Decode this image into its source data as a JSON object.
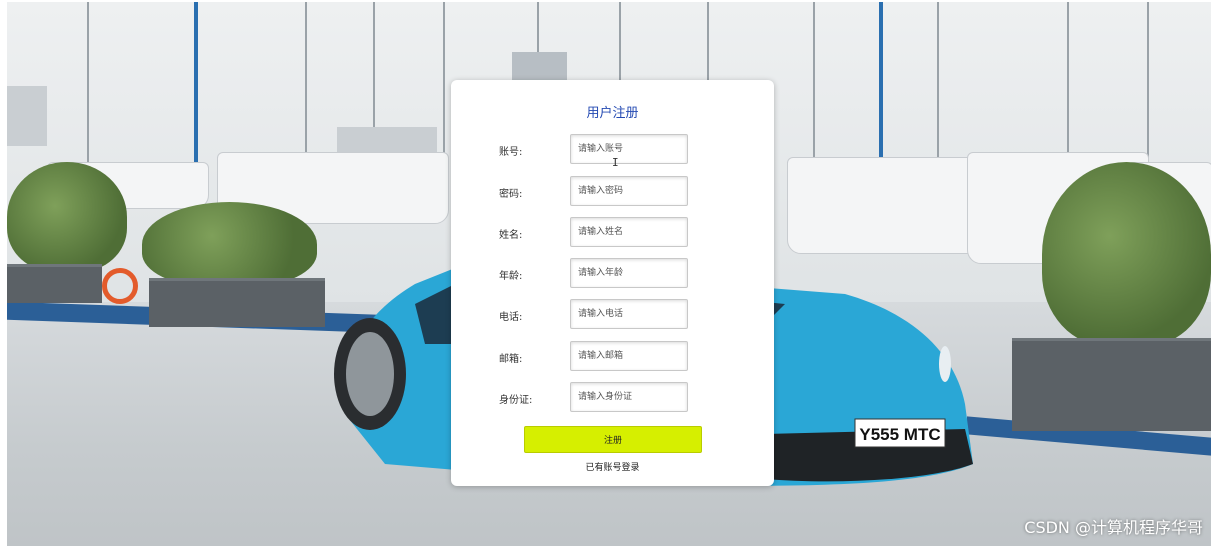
{
  "background": {
    "plate": "Y555 MTC"
  },
  "form": {
    "title": "用户注册",
    "fields": [
      {
        "label": "账号:",
        "placeholder": "请输入账号"
      },
      {
        "label": "密码:",
        "placeholder": "请输入密码"
      },
      {
        "label": "姓名:",
        "placeholder": "请输入姓名"
      },
      {
        "label": "年龄:",
        "placeholder": "请输入年龄"
      },
      {
        "label": "电话:",
        "placeholder": "请输入电话"
      },
      {
        "label": "邮箱:",
        "placeholder": "请输入邮箱"
      },
      {
        "label": "身份证:",
        "placeholder": "请输入身份证"
      }
    ],
    "submit_label": "注册",
    "login_link": "已有账号登录"
  },
  "watermark": "CSDN @计算机程序华哥",
  "colors": {
    "title": "#2349b2",
    "submit": "#d6ef00",
    "car": "#2aa7d6",
    "stripe": "#2b5f97"
  }
}
